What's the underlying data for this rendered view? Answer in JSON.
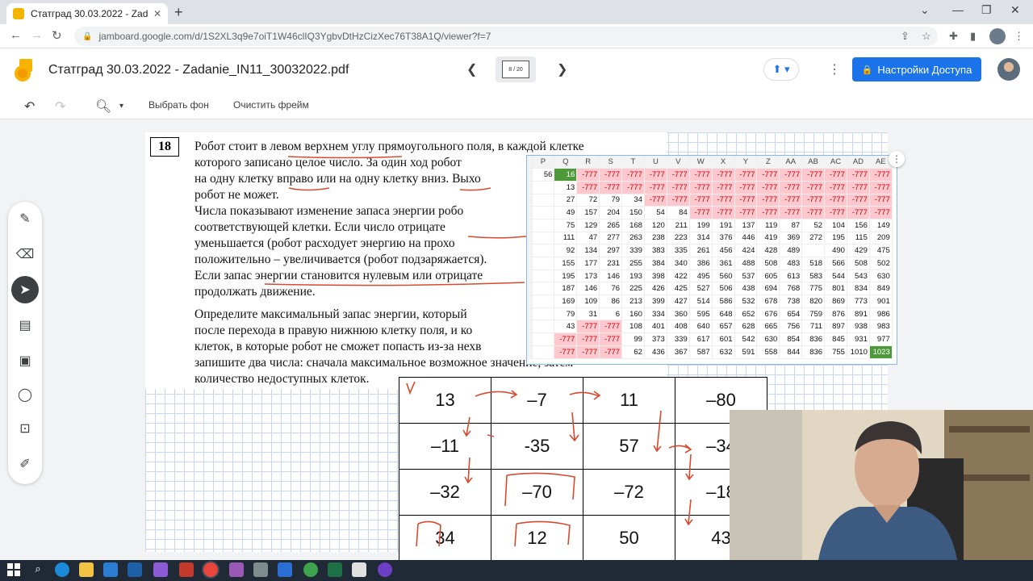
{
  "browser": {
    "tab_title": "Статград 30.03.2022 - Zadanie_IN",
    "tab_close": "✕",
    "new_tab": "+",
    "url": "jamboard.google.com/d/1S2XL3q9e7oiT1W46clIQ3YgbvDtHzCizXec76T38A1Q/viewer?f=7",
    "lock_icon": "lock-icon"
  },
  "jam": {
    "title": "Статград 30.03.2022 - Zadanie_IN11_30032022.pdf",
    "frame_counter": "8 / 20",
    "access_button": "Настройки Доступа"
  },
  "toolbar": {
    "bg_button": "Выбрать фон",
    "clear_button": "Очистить фрейм"
  },
  "problem": {
    "number": "18",
    "lines": [
      "Робот стоит в левом верхнем углу прямоугольного поля, в каждой клетке",
      "которого записано целое число. За один ход робот",
      "на одну клетку вправо или на одну клетку вниз. Выхо",
      "робот не может.",
      "Числа показывают изменение запаса энергии робо",
      "соответствующей клетки. Если число отрицате",
      "уменьшается (робот расходует энергию на прохо",
      "положительно – увеличивается (робот подзаряжается).",
      "Если запас энергии становится нулевым или отрицате",
      "продолжать движение.",
      "Определите максимальный запас энергии, который",
      "после перехода в правую нижнюю клетку поля, и ко",
      "клеток, в которые робот не сможет попасть из-за нехв",
      "запишите два числа: сначала максимальное возможное значение, затем",
      "количество недоступных клеток."
    ]
  },
  "number_grid": [
    [
      "13",
      "–7",
      "11",
      "–80"
    ],
    [
      "–11",
      "-35",
      "57",
      "–34"
    ],
    [
      "–32",
      "–70",
      "–72",
      "–18"
    ],
    [
      "34",
      "12",
      "50",
      "43"
    ]
  ],
  "spreadsheet": {
    "columns": [
      "P",
      "Q",
      "R",
      "S",
      "T",
      "U",
      "V",
      "W",
      "X",
      "Y",
      "Z",
      "AA",
      "AB",
      "AC",
      "AD",
      "AE"
    ],
    "rows": [
      [
        "56",
        "16",
        "-777",
        "-777",
        "-777",
        "-777",
        "-777",
        "-777",
        "-777",
        "-777",
        "-777",
        "-777",
        "-777",
        "-777",
        "-777",
        "-777"
      ],
      [
        "",
        "13",
        "-777",
        "-777",
        "-777",
        "-777",
        "-777",
        "-777",
        "-777",
        "-777",
        "-777",
        "-777",
        "-777",
        "-777",
        "-777",
        "-777"
      ],
      [
        "",
        "27",
        "72",
        "79",
        "34",
        "-777",
        "-777",
        "-777",
        "-777",
        "-777",
        "-777",
        "-777",
        "-777",
        "-777",
        "-777",
        "-777"
      ],
      [
        "",
        "49",
        "157",
        "204",
        "150",
        "54",
        "84",
        "-777",
        "-777",
        "-777",
        "-777",
        "-777",
        "-777",
        "-777",
        "-777",
        "-777"
      ],
      [
        "",
        "75",
        "129",
        "265",
        "168",
        "120",
        "211",
        "199",
        "191",
        "137",
        "119",
        "87",
        "52",
        "104",
        "156",
        "149"
      ],
      [
        "",
        "111",
        "47",
        "277",
        "263",
        "238",
        "223",
        "314",
        "376",
        "446",
        "419",
        "369",
        "272",
        "195",
        "115",
        "209"
      ],
      [
        "",
        "92",
        "134",
        "297",
        "339",
        "383",
        "335",
        "261",
        "456",
        "424",
        "428",
        "489",
        "",
        "490",
        "429",
        "475"
      ],
      [
        "",
        "155",
        "177",
        "231",
        "255",
        "384",
        "340",
        "386",
        "361",
        "488",
        "508",
        "483",
        "518",
        "566",
        "508",
        "502"
      ],
      [
        "",
        "195",
        "173",
        "146",
        "193",
        "398",
        "422",
        "495",
        "560",
        "537",
        "605",
        "613",
        "583",
        "544",
        "543",
        "630"
      ],
      [
        "",
        "187",
        "146",
        "76",
        "225",
        "426",
        "425",
        "527",
        "506",
        "438",
        "694",
        "768",
        "775",
        "801",
        "834",
        "849"
      ],
      [
        "",
        "169",
        "109",
        "86",
        "213",
        "399",
        "427",
        "514",
        "586",
        "532",
        "678",
        "738",
        "820",
        "869",
        "773",
        "901"
      ],
      [
        "",
        "79",
        "31",
        "6",
        "160",
        "334",
        "360",
        "595",
        "648",
        "652",
        "676",
        "654",
        "759",
        "876",
        "891",
        "986"
      ],
      [
        "",
        "43",
        "-777",
        "-777",
        "108",
        "401",
        "408",
        "640",
        "657",
        "628",
        "665",
        "756",
        "711",
        "897",
        "938",
        "983"
      ],
      [
        "",
        "-777",
        "-777",
        "-777",
        "99",
        "373",
        "339",
        "617",
        "601",
        "542",
        "630",
        "854",
        "836",
        "845",
        "931",
        "977"
      ],
      [
        "",
        "-777",
        "-777",
        "-777",
        "62",
        "436",
        "367",
        "587",
        "632",
        "591",
        "558",
        "844",
        "836",
        "755",
        "1010",
        "1023"
      ]
    ]
  },
  "rail_icons": [
    "pen-icon",
    "eraser-icon",
    "select-icon",
    "sticky-note-icon",
    "image-icon",
    "circle-icon",
    "text-box-icon",
    "laser-icon"
  ],
  "colors": {
    "accent": "#1a73e8",
    "negative_fill": "#ffc7ce",
    "negative_text": "#c00000",
    "highlight_green": "#4e9a3b"
  }
}
